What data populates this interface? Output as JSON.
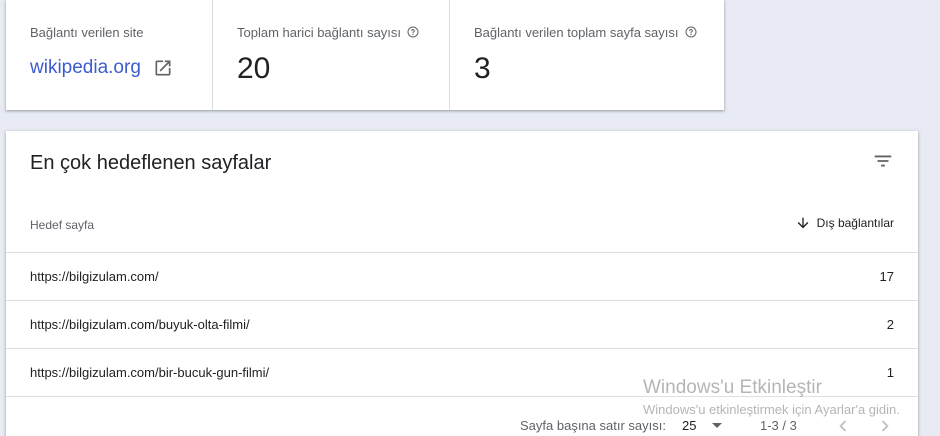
{
  "summary": {
    "linked_site_label": "Bağlantı verilen site",
    "linked_site": "wikipedia.org",
    "external_links_label": "Toplam harici bağlantı sayısı",
    "external_links_value": "20",
    "linked_pages_label": "Bağlantı verilen toplam sayfa sayısı",
    "linked_pages_value": "3"
  },
  "table": {
    "title": "En çok hedeflenen sayfalar",
    "col_target": "Hedef sayfa",
    "col_links": "Dış bağlantılar",
    "rows": [
      {
        "url": "https://bilgizulam.com/",
        "count": "17"
      },
      {
        "url": "https://bilgizulam.com/buyuk-olta-filmi/",
        "count": "2"
      },
      {
        "url": "https://bilgizulam.com/bir-bucuk-gun-filmi/",
        "count": "1"
      }
    ],
    "footer": {
      "rows_per_page_label": "Sayfa başına satır sayısı:",
      "rows_per_page": "25",
      "range": "1-3 / 3"
    }
  },
  "watermark": {
    "title": "Windows'u Etkinleştir",
    "subtitle": "Windows'u etkinleştirmek için Ayarlar'a gidin."
  },
  "colors": {
    "link": "#3c5ccf",
    "background": "#e8ebf4"
  },
  "icons": [
    "help-icon",
    "open-in-new-icon",
    "filter-icon",
    "arrow-down-icon",
    "chevron-left-icon",
    "chevron-right-icon"
  ]
}
